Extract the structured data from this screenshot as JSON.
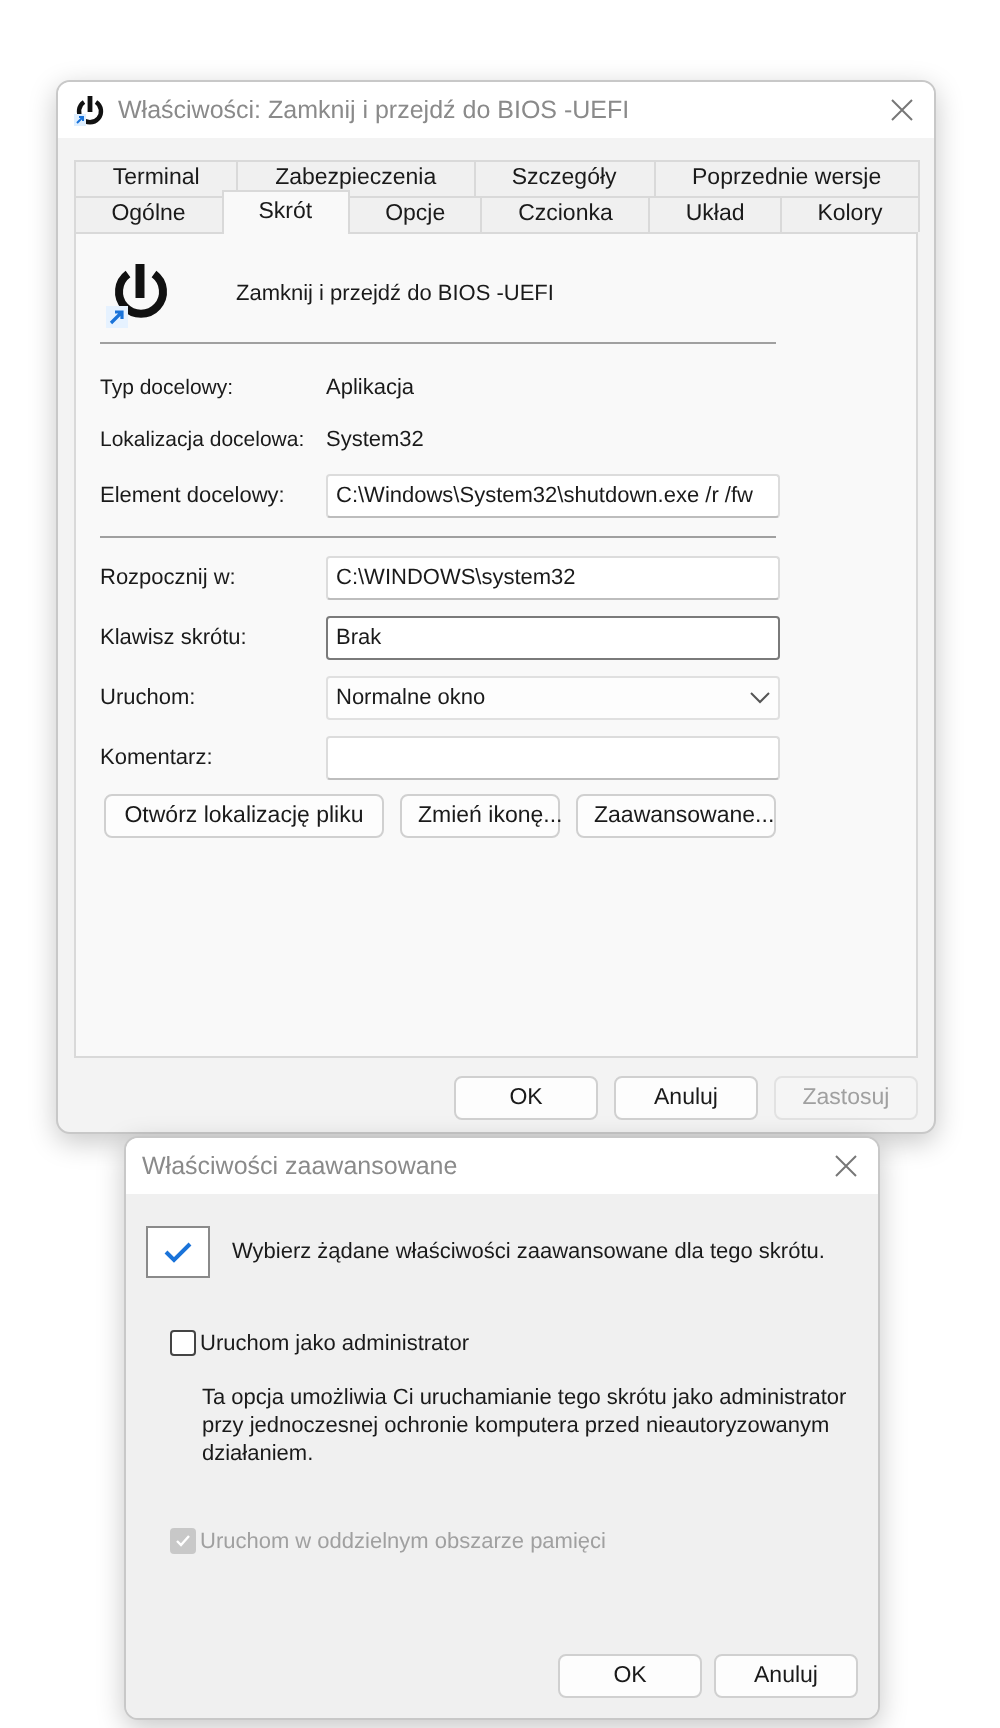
{
  "properties_window": {
    "title": "Właściwości: Zamknij i przejdź do BIOS -UEFI",
    "tab_rows": [
      [
        {
          "label": "Terminal",
          "selected": false
        },
        {
          "label": "Zabezpieczenia",
          "selected": false
        },
        {
          "label": "Szczegóły",
          "selected": false
        },
        {
          "label": "Poprzednie wersje",
          "selected": false
        }
      ],
      [
        {
          "label": "Ogólne",
          "selected": false
        },
        {
          "label": "Skrót",
          "selected": true
        },
        {
          "label": "Opcje",
          "selected": false
        },
        {
          "label": "Czcionka",
          "selected": false
        },
        {
          "label": "Układ",
          "selected": false
        },
        {
          "label": "Kolory",
          "selected": false
        }
      ]
    ],
    "shortcut_name": "Zamknij i przejdź do BIOS -UEFI",
    "info": [
      {
        "label": "Typ docelowy:",
        "value": "Aplikacja"
      },
      {
        "label": "Lokalizacja docelowa:",
        "value": "System32"
      }
    ],
    "target": {
      "kind": "text",
      "label": "Element docelowy:",
      "value": "C:\\Windows\\System32\\shutdown.exe /r /fw",
      "focused": false
    },
    "fields": [
      {
        "kind": "text",
        "label": "Rozpocznij w:",
        "value": "C:\\WINDOWS\\system32",
        "focused": false
      },
      {
        "kind": "text",
        "label": "Klawisz skrótu:",
        "value": "Brak",
        "focused": true
      },
      {
        "kind": "dropdown",
        "label": "Uruchom:",
        "value": "Normalne okno",
        "focused": false
      },
      {
        "kind": "text",
        "label": "Komentarz:",
        "focused": false
      }
    ],
    "action_buttons": [
      {
        "label": "Otwórz lokalizację pliku",
        "disabled": false
      },
      {
        "label": "Zmień ikonę...",
        "disabled": false
      },
      {
        "label": "Zaawansowane...",
        "disabled": false
      }
    ],
    "dialog_buttons": [
      {
        "label": "OK",
        "disabled": false
      },
      {
        "label": "Anuluj",
        "disabled": false
      },
      {
        "label": "Zastosuj",
        "disabled": true
      }
    ]
  },
  "advanced_window": {
    "title": "Właściwości zaawansowane",
    "intro": "Wybierz żądane właściwości zaawansowane dla tego skrótu.",
    "options": [
      {
        "label": "Uruchom jako administrator",
        "checked": false,
        "disabled": false,
        "description": "Ta opcja umożliwia Ci uruchamianie tego skrótu jako administrator przy jednoczesnej ochronie komputera przed nieautoryzowanym działaniem."
      },
      {
        "label": "Uruchom w oddzielnym obszarze pamięci",
        "checked": true,
        "disabled": true
      }
    ],
    "buttons": [
      {
        "label": "OK",
        "disabled": false
      },
      {
        "label": "Anuluj",
        "disabled": false
      }
    ]
  }
}
